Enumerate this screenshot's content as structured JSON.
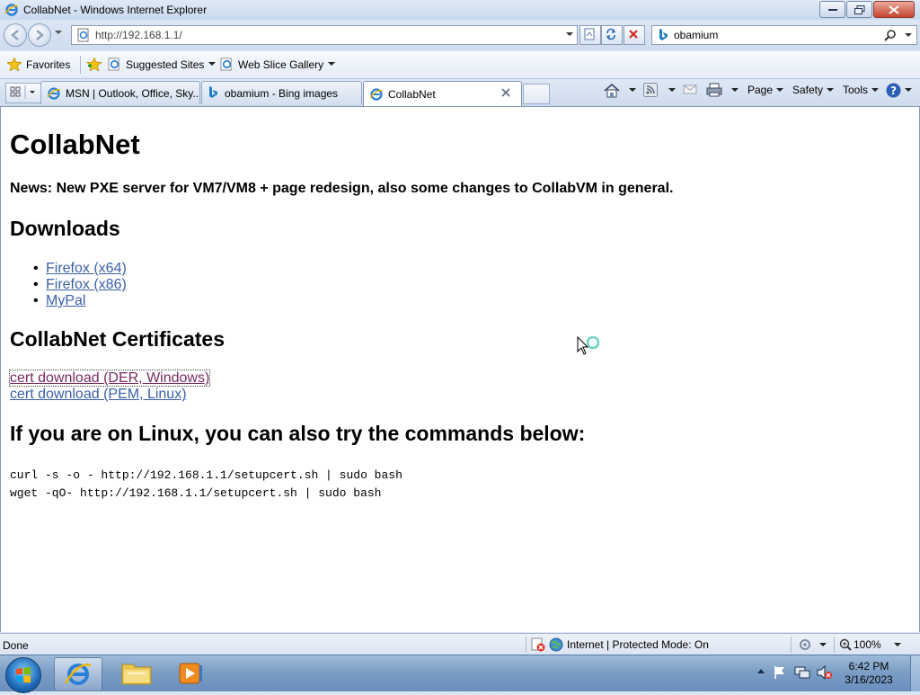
{
  "window": {
    "title": "CollabNet - Windows Internet Explorer"
  },
  "address_bar": {
    "url": "http://192.168.1.1/"
  },
  "search": {
    "query": "obamium"
  },
  "favorites_bar": {
    "favorites_label": "Favorites",
    "suggested_sites": "Suggested Sites",
    "web_slice_gallery": "Web Slice Gallery"
  },
  "tabs": [
    {
      "label": "MSN | Outlook, Office, Sky...",
      "icon": "ie-icon"
    },
    {
      "label": "obamium - Bing images",
      "icon": "bing-icon"
    },
    {
      "label": "CollabNet",
      "icon": "ie-icon",
      "active": true
    }
  ],
  "command_bar": {
    "page": "Page",
    "safety": "Safety",
    "tools": "Tools"
  },
  "page": {
    "heading": "CollabNet",
    "news": "News: New PXE server for VM7/VM8 + page redesign, also some changes to CollabVM in general.",
    "downloads_heading": "Downloads",
    "downloads": [
      "Firefox (x64)",
      "Firefox (x86)",
      "MyPal"
    ],
    "certs_heading": "CollabNet Certificates",
    "certs": [
      "cert download (DER, Windows)",
      "cert download (PEM, Linux)"
    ],
    "linux_heading": "If you are on Linux, you can also try the commands below:",
    "commands": [
      "curl -s -o - http://192.168.1.1/setupcert.sh | sudo bash",
      "wget -qO- http://192.168.1.1/setupcert.sh | sudo bash"
    ]
  },
  "status_bar": {
    "status": "Done",
    "zone": "Internet | Protected Mode: On",
    "zoom": "100%"
  },
  "taskbar": {
    "time": "6:42 PM",
    "date": "3/16/2023"
  },
  "colors": {
    "link": "#3a5fa8",
    "visited_link": "#7a2a60",
    "chrome_blue": "#dbe6f4"
  }
}
